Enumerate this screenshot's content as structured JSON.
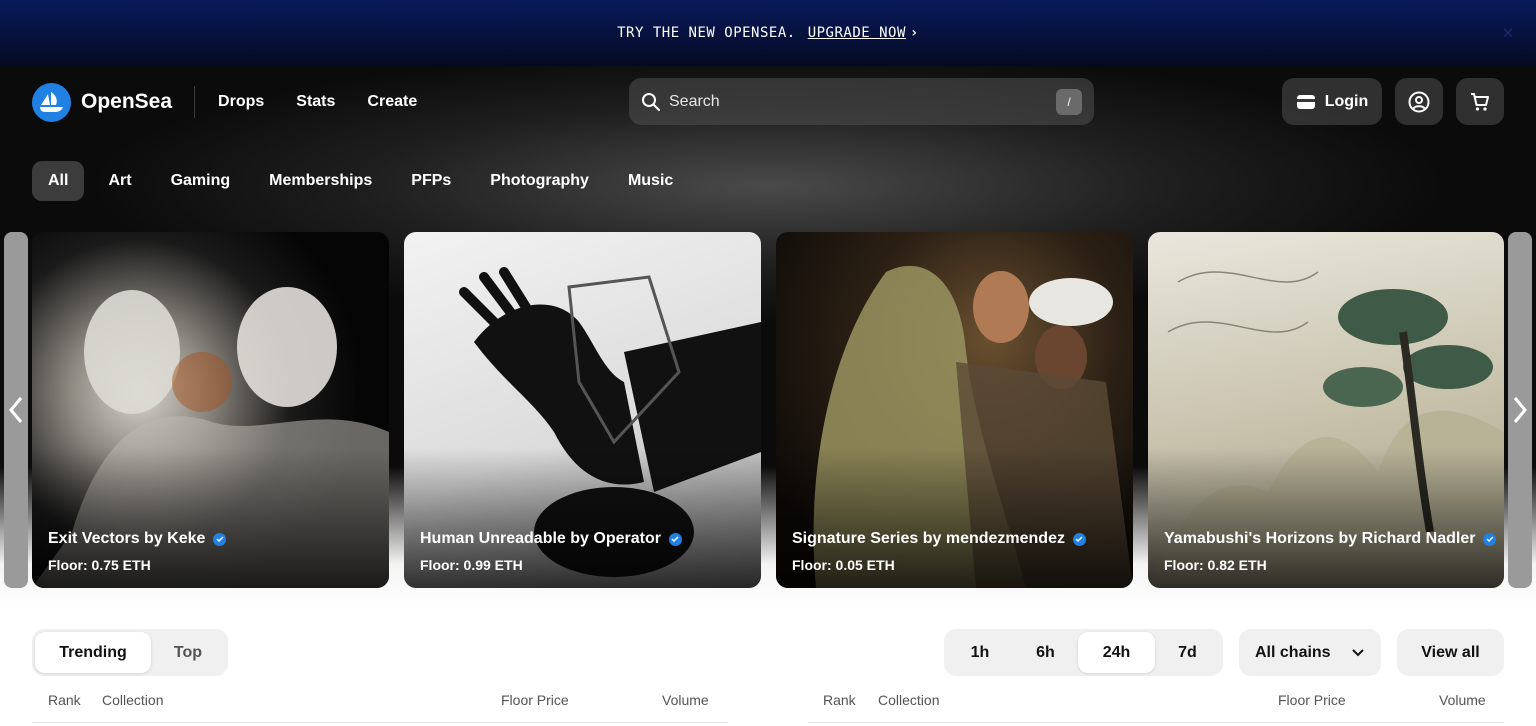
{
  "banner": {
    "text": "TRY THE NEW OPENSEA.",
    "link": "UPGRADE NOW"
  },
  "brand": {
    "name": "OpenSea",
    "accent": "#2081e2"
  },
  "nav": {
    "links": [
      "Drops",
      "Stats",
      "Create"
    ]
  },
  "search": {
    "placeholder": "Search",
    "shortcut": "/"
  },
  "actions": {
    "login": "Login"
  },
  "categories": [
    "All",
    "Art",
    "Gaming",
    "Memberships",
    "PFPs",
    "Photography",
    "Music"
  ],
  "carousel": [
    {
      "title": "Exit Vectors by Keke",
      "floor": "Floor: 0.75 ETH",
      "verified": true
    },
    {
      "title": "Human Unreadable by Operator",
      "floor": "Floor: 0.99 ETH",
      "verified": true
    },
    {
      "title": "Signature Series by mendezmendez",
      "floor": "Floor: 0.05 ETH",
      "verified": true
    },
    {
      "title": "Yamabushi's Horizons by Richard Nadler",
      "floor": "Floor: 0.82 ETH",
      "verified": true
    }
  ],
  "ranking": {
    "tabs": [
      "Trending",
      "Top"
    ],
    "active_tab": "Trending",
    "periods": [
      "1h",
      "6h",
      "24h",
      "7d"
    ],
    "active_period": "24h",
    "chain": "All chains",
    "view_all": "View all",
    "columns": {
      "rank": "Rank",
      "collection": "Collection",
      "floor": "Floor Price",
      "volume": "Volume"
    }
  }
}
